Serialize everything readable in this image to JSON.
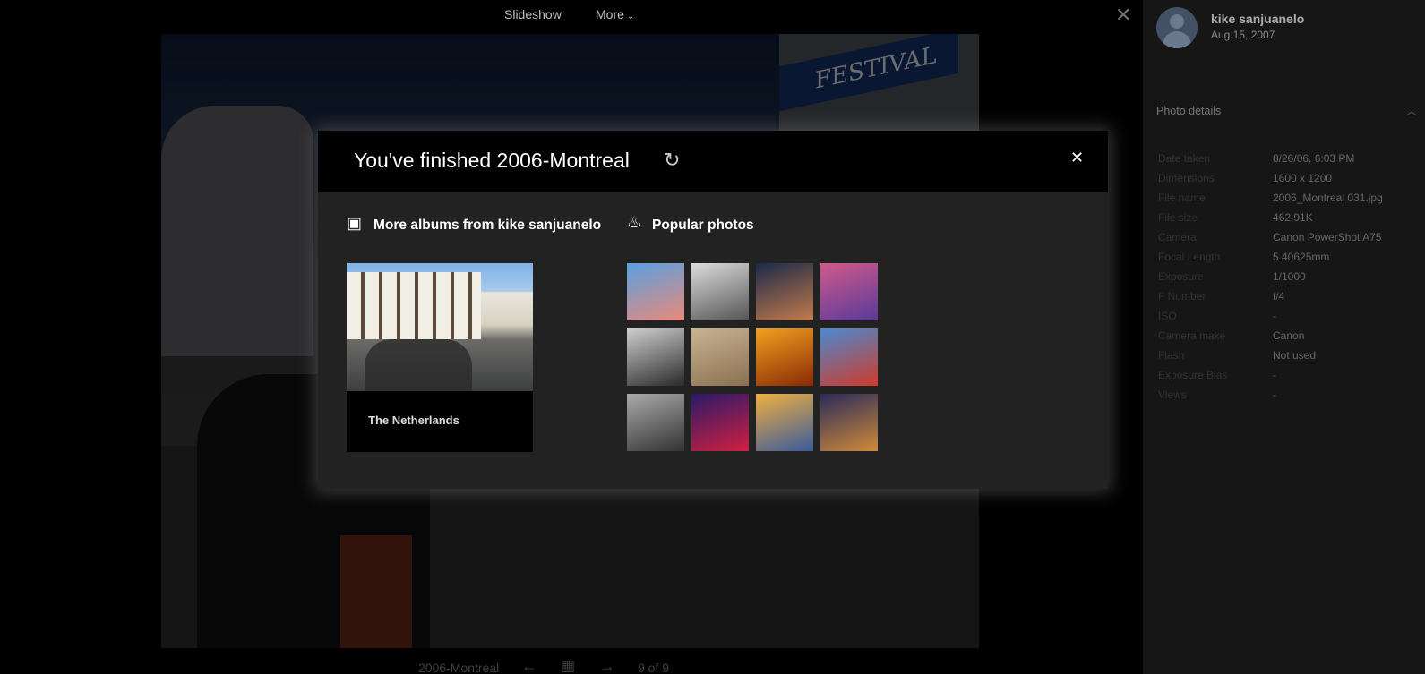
{
  "topbar": {
    "slideshow": "Slideshow",
    "more": "More",
    "more_chevron": "⌄",
    "close": "✕"
  },
  "background_photo": {
    "sign_text": "FESTIVAL"
  },
  "bottombar": {
    "album": "2006-Montreal",
    "prev": "←",
    "grid": "▦",
    "next": "→",
    "counter": "9 of 9"
  },
  "sidebar": {
    "username": "kike sanjuanelo",
    "date": "Aug 15, 2007",
    "details_title": "Photo details",
    "details_chevron": "︿",
    "details": [
      {
        "key": "Date taken",
        "value": "8/26/06, 6:03 PM"
      },
      {
        "key": "Dimensions",
        "value": "1600 x 1200"
      },
      {
        "key": "File name",
        "value": "2006_Montreal 031.jpg"
      },
      {
        "key": "File size",
        "value": "462.91K"
      },
      {
        "key": "Camera",
        "value": "Canon PowerShot A75"
      },
      {
        "key": "Focal Length",
        "value": "5.40625mm"
      },
      {
        "key": "Exposure",
        "value": "1/1000"
      },
      {
        "key": "F Number",
        "value": "f/4"
      },
      {
        "key": "ISO",
        "value": "-"
      },
      {
        "key": "Camera make",
        "value": "Canon"
      },
      {
        "key": "Flash",
        "value": "Not used"
      },
      {
        "key": "Exposure Bias",
        "value": "-"
      },
      {
        "key": "Views",
        "value": "-"
      }
    ]
  },
  "modal": {
    "title": "You've finished 2006-Montreal",
    "replay_icon": "↻",
    "close": "✕",
    "albums_icon": "▣",
    "albums_title": "More albums from kike sanjuanelo",
    "album_card_label": "The Netherlands",
    "popular_icon": "♨",
    "popular_title": "Popular photos",
    "popular_photos": [
      {
        "name": "pink-umbrellas",
        "colors": [
          "#5aa0e0",
          "#e98a7a"
        ]
      },
      {
        "name": "bw-ship",
        "colors": [
          "#dcdcdc",
          "#555555"
        ]
      },
      {
        "name": "girl-curtain",
        "colors": [
          "#1b2a4a",
          "#c47a4a"
        ]
      },
      {
        "name": "lavender-sunset",
        "colors": [
          "#d05a8a",
          "#5a3a9a"
        ]
      },
      {
        "name": "bw-sculpture",
        "colors": [
          "#cfcfcf",
          "#2a2a2a"
        ]
      },
      {
        "name": "sepia-landscape",
        "colors": [
          "#c9b392",
          "#8a7050"
        ]
      },
      {
        "name": "fire-explosion",
        "colors": [
          "#f0a020",
          "#8a2a05"
        ]
      },
      {
        "name": "tulip-field",
        "colors": [
          "#4a8ad0",
          "#d03a2a"
        ]
      },
      {
        "name": "bw-monkey",
        "colors": [
          "#aaaaaa",
          "#333333"
        ]
      },
      {
        "name": "red-balls",
        "colors": [
          "#2a1a6a",
          "#d02040"
        ]
      },
      {
        "name": "sunset-clouds",
        "colors": [
          "#f0b040",
          "#3a5a9a"
        ]
      },
      {
        "name": "boat-lights",
        "colors": [
          "#2a2a5a",
          "#d08a3a"
        ]
      }
    ]
  }
}
